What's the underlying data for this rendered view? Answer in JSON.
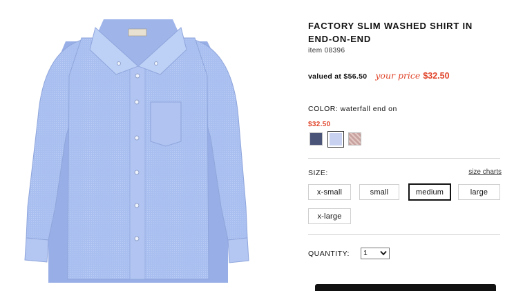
{
  "product": {
    "image_alt": "blue button-down shirt",
    "title": "FACTORY SLIM WASHED SHIRT IN END-ON-END",
    "item_number": "item 08396"
  },
  "pricing": {
    "valued_at": "valued at $56.50",
    "your_price_label": "your price",
    "your_price": "$32.50",
    "accent_color": "#e0442a"
  },
  "color": {
    "label": "COLOR: waterfall end on",
    "swatch_price": "$32.50",
    "swatches": [
      {
        "name": "navy-swatch",
        "color": "#4a5478",
        "selected": false
      },
      {
        "name": "light-blue-swatch",
        "color": "#c8d2f0",
        "selected": true
      },
      {
        "name": "pink-stripe-swatch",
        "color": "#c8a29e",
        "selected": false
      }
    ]
  },
  "size": {
    "label": "SIZE:",
    "size_charts_link": "size charts",
    "options": [
      "x-small",
      "small",
      "medium",
      "large",
      "x-large"
    ],
    "selected": "medium"
  },
  "quantity": {
    "label": "QUANTITY:",
    "value": "1"
  }
}
